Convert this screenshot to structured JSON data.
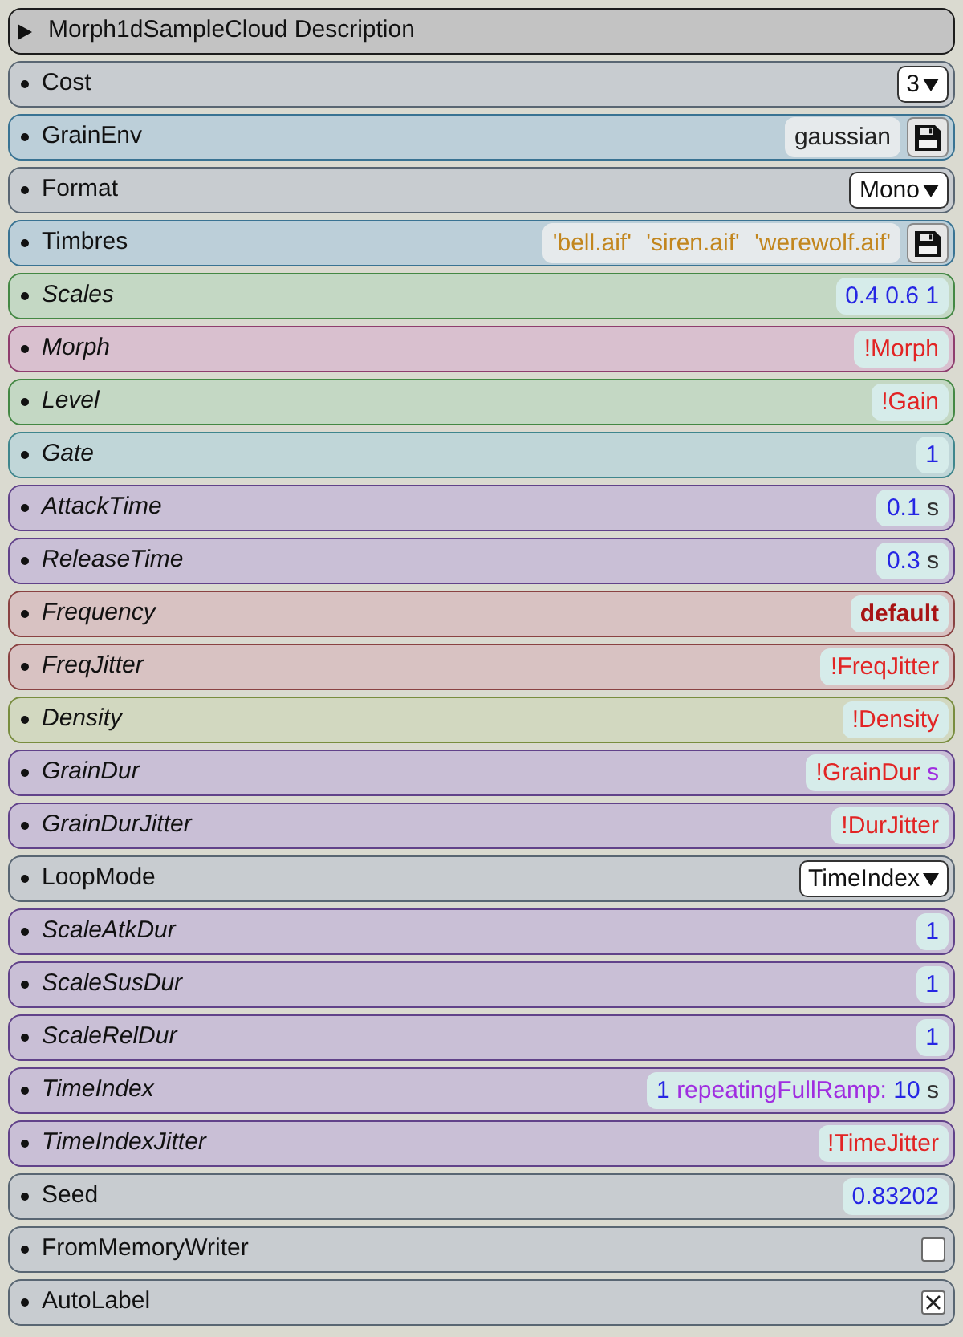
{
  "header": {
    "title": "Morph1dSampleCloud Description",
    "expanded": false
  },
  "parameters": [
    {
      "label": "Cost",
      "italic": false,
      "color": "#c8ccd0",
      "kind": "menu",
      "value": "3"
    },
    {
      "label": "GrainEnv",
      "italic": false,
      "color": "#bccfd9",
      "kind": "file",
      "tokens": [
        {
          "kind": "plain",
          "text": "gaussian"
        }
      ]
    },
    {
      "label": "Format",
      "italic": false,
      "color": "#c8ccd0",
      "kind": "menu",
      "value": "Mono"
    },
    {
      "label": "Timbres",
      "italic": false,
      "color": "#bccfd9",
      "kind": "file",
      "tokens": [
        {
          "kind": "string",
          "text": "'bell.aif'"
        },
        {
          "kind": "string",
          "text": "'siren.aif'"
        },
        {
          "kind": "string",
          "text": "'werewolf.aif'"
        }
      ]
    },
    {
      "label": "Scales",
      "italic": true,
      "color": "#c4d8c4",
      "kind": "field",
      "tokens": [
        {
          "kind": "number",
          "text": "0.4"
        },
        {
          "kind": "number",
          "text": "0.6"
        },
        {
          "kind": "number",
          "text": "1"
        }
      ]
    },
    {
      "label": "Morph",
      "italic": true,
      "color": "#d9c0cf",
      "kind": "field",
      "tokens": [
        {
          "kind": "event",
          "text": "!Morph"
        }
      ]
    },
    {
      "label": "Level",
      "italic": true,
      "color": "#c4d8c4",
      "kind": "field",
      "tokens": [
        {
          "kind": "event",
          "text": "!Gain"
        }
      ]
    },
    {
      "label": "Gate",
      "italic": true,
      "color": "#c0d6d8",
      "kind": "field",
      "tokens": [
        {
          "kind": "number",
          "text": "1"
        }
      ]
    },
    {
      "label": "AttackTime",
      "italic": true,
      "color": "#c9bfd6",
      "kind": "field",
      "tokens": [
        {
          "kind": "number",
          "text": "0.1"
        },
        {
          "kind": "unit",
          "text": "s"
        }
      ]
    },
    {
      "label": "ReleaseTime",
      "italic": true,
      "color": "#c9bfd6",
      "kind": "field",
      "tokens": [
        {
          "kind": "number",
          "text": "0.3"
        },
        {
          "kind": "unit",
          "text": "s"
        }
      ]
    },
    {
      "label": "Frequency",
      "italic": true,
      "color": "#d8c2c2",
      "kind": "field",
      "tokens": [
        {
          "kind": "default",
          "text": "default"
        }
      ]
    },
    {
      "label": "FreqJitter",
      "italic": true,
      "color": "#d8c2c2",
      "kind": "field",
      "tokens": [
        {
          "kind": "event",
          "text": "!FreqJitter"
        }
      ]
    },
    {
      "label": "Density",
      "italic": true,
      "color": "#d2d8c0",
      "kind": "field",
      "tokens": [
        {
          "kind": "event",
          "text": "!Density"
        }
      ]
    },
    {
      "label": "GrainDur",
      "italic": true,
      "color": "#c9bfd6",
      "kind": "field",
      "tokens": [
        {
          "kind": "event",
          "text": "!GrainDur"
        },
        {
          "kind": "symbol",
          "text": "s"
        }
      ]
    },
    {
      "label": "GrainDurJitter",
      "italic": true,
      "color": "#c9bfd6",
      "kind": "field",
      "tokens": [
        {
          "kind": "event",
          "text": "!DurJitter"
        }
      ]
    },
    {
      "label": "LoopMode",
      "italic": false,
      "color": "#c8ccd0",
      "kind": "menu",
      "value": "TimeIndex"
    },
    {
      "label": "ScaleAtkDur",
      "italic": true,
      "color": "#c9bfd6",
      "kind": "field",
      "tokens": [
        {
          "kind": "number",
          "text": "1"
        }
      ]
    },
    {
      "label": "ScaleSusDur",
      "italic": true,
      "color": "#c9bfd6",
      "kind": "field",
      "tokens": [
        {
          "kind": "number",
          "text": "1"
        }
      ]
    },
    {
      "label": "ScaleRelDur",
      "italic": true,
      "color": "#c9bfd6",
      "kind": "field",
      "tokens": [
        {
          "kind": "number",
          "text": "1"
        }
      ]
    },
    {
      "label": "TimeIndex",
      "italic": true,
      "color": "#c9bfd6",
      "kind": "field",
      "tokens": [
        {
          "kind": "number",
          "text": "1"
        },
        {
          "kind": "symbol",
          "text": "repeatingFullRamp:"
        },
        {
          "kind": "number",
          "text": "10"
        },
        {
          "kind": "unit",
          "text": "s"
        }
      ]
    },
    {
      "label": "TimeIndexJitter",
      "italic": true,
      "color": "#c9bfd6",
      "kind": "field",
      "tokens": [
        {
          "kind": "event",
          "text": "!TimeJitter"
        }
      ]
    },
    {
      "label": "Seed",
      "italic": false,
      "color": "#c8ccd0",
      "kind": "field",
      "tokens": [
        {
          "kind": "number",
          "text": "0.83202"
        }
      ]
    },
    {
      "label": "FromMemoryWriter",
      "italic": false,
      "color": "#c8ccd0",
      "kind": "checkbox",
      "checked": false
    },
    {
      "label": "AutoLabel",
      "italic": false,
      "color": "#c8ccd0",
      "kind": "checkbox",
      "checked": true
    }
  ]
}
